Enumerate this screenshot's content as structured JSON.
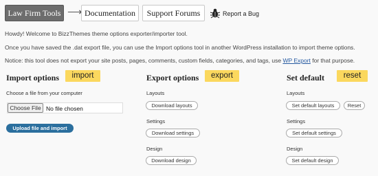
{
  "top_nav": {
    "active_tab": "Law Firm Tools",
    "documentation": "Documentation",
    "support_forums": "Support Forums",
    "report_bug": "Report a Bug"
  },
  "intro": {
    "line1": "Howdy! Welcome to BizzThemes theme options exporter/importer tool.",
    "line2": "Once you have saved the .dat export file, you can use the Import options tool in another WordPress installation to import theme options.",
    "line3_before": "Notice: this tool does not export your site posts, pages, comments, custom fields, categories, and tags, use ",
    "line3_link": "WP Export",
    "line3_after": " for that purpose."
  },
  "import": {
    "title": "Import options",
    "tag": "import",
    "choose_label": "Choose a file from your computer",
    "choose_button": "Choose File",
    "file_status": "No file chosen",
    "upload_button": "Upload file and import"
  },
  "export": {
    "title": "Export options",
    "tag": "export",
    "layouts_label": "Layouts",
    "layouts_button": "Download layouts",
    "settings_label": "Settings",
    "settings_button": "Download settings",
    "design_label": "Design",
    "design_button": "Download design"
  },
  "reset": {
    "title": "Set default",
    "tag": "reset",
    "layouts_label": "Layouts",
    "layouts_button": "Set default layouts",
    "reset_button": "Reset",
    "settings_label": "Settings",
    "settings_button": "Set default settings",
    "design_label": "Design",
    "design_button": "Set default design"
  },
  "colors": {
    "tag_yellow": "#fbd85e",
    "active_tab": "#6d6d6d",
    "upload_blue": "#2b6f9e",
    "link_blue": "#2358a0"
  }
}
